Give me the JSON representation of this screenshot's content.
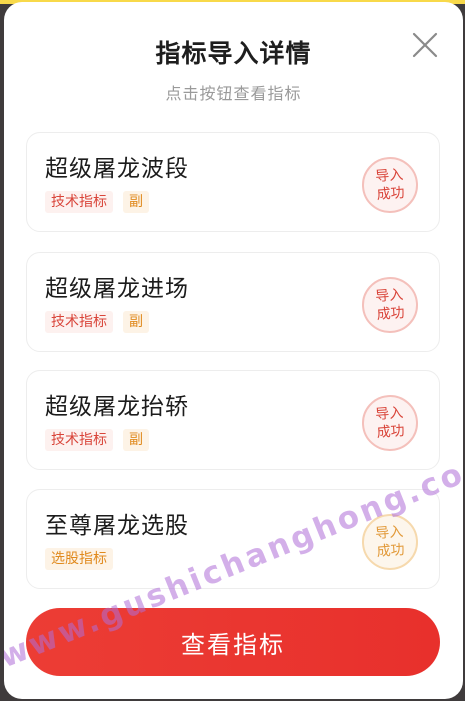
{
  "modal": {
    "title": "指标导入详情",
    "subtitle": "点击按钮查看指标"
  },
  "cards": [
    {
      "name": "超级屠龙波段",
      "tags": [
        "技术指标",
        "副"
      ],
      "badge_line1": "导入",
      "badge_line2": "成功"
    },
    {
      "name": "超级屠龙进场",
      "tags": [
        "技术指标",
        "副"
      ],
      "badge_line1": "导入",
      "badge_line2": "成功"
    },
    {
      "name": "超级屠龙抬轿",
      "tags": [
        "技术指标",
        "副"
      ],
      "badge_line1": "导入",
      "badge_line2": "成功"
    },
    {
      "name": "至尊屠龙选股",
      "tags": [
        "选股指标"
      ],
      "badge_line1": "导入",
      "badge_line2": "成功"
    }
  ],
  "button": {
    "label": "查看指标"
  },
  "watermark": "www.gushichanghong.com",
  "colors": {
    "primary_red": "#e8302c",
    "tag_red": "#d9453a",
    "tag_orange": "#e08a1e",
    "badge_orange": "#e29a3a"
  },
  "icons": {
    "close": "close-icon"
  }
}
